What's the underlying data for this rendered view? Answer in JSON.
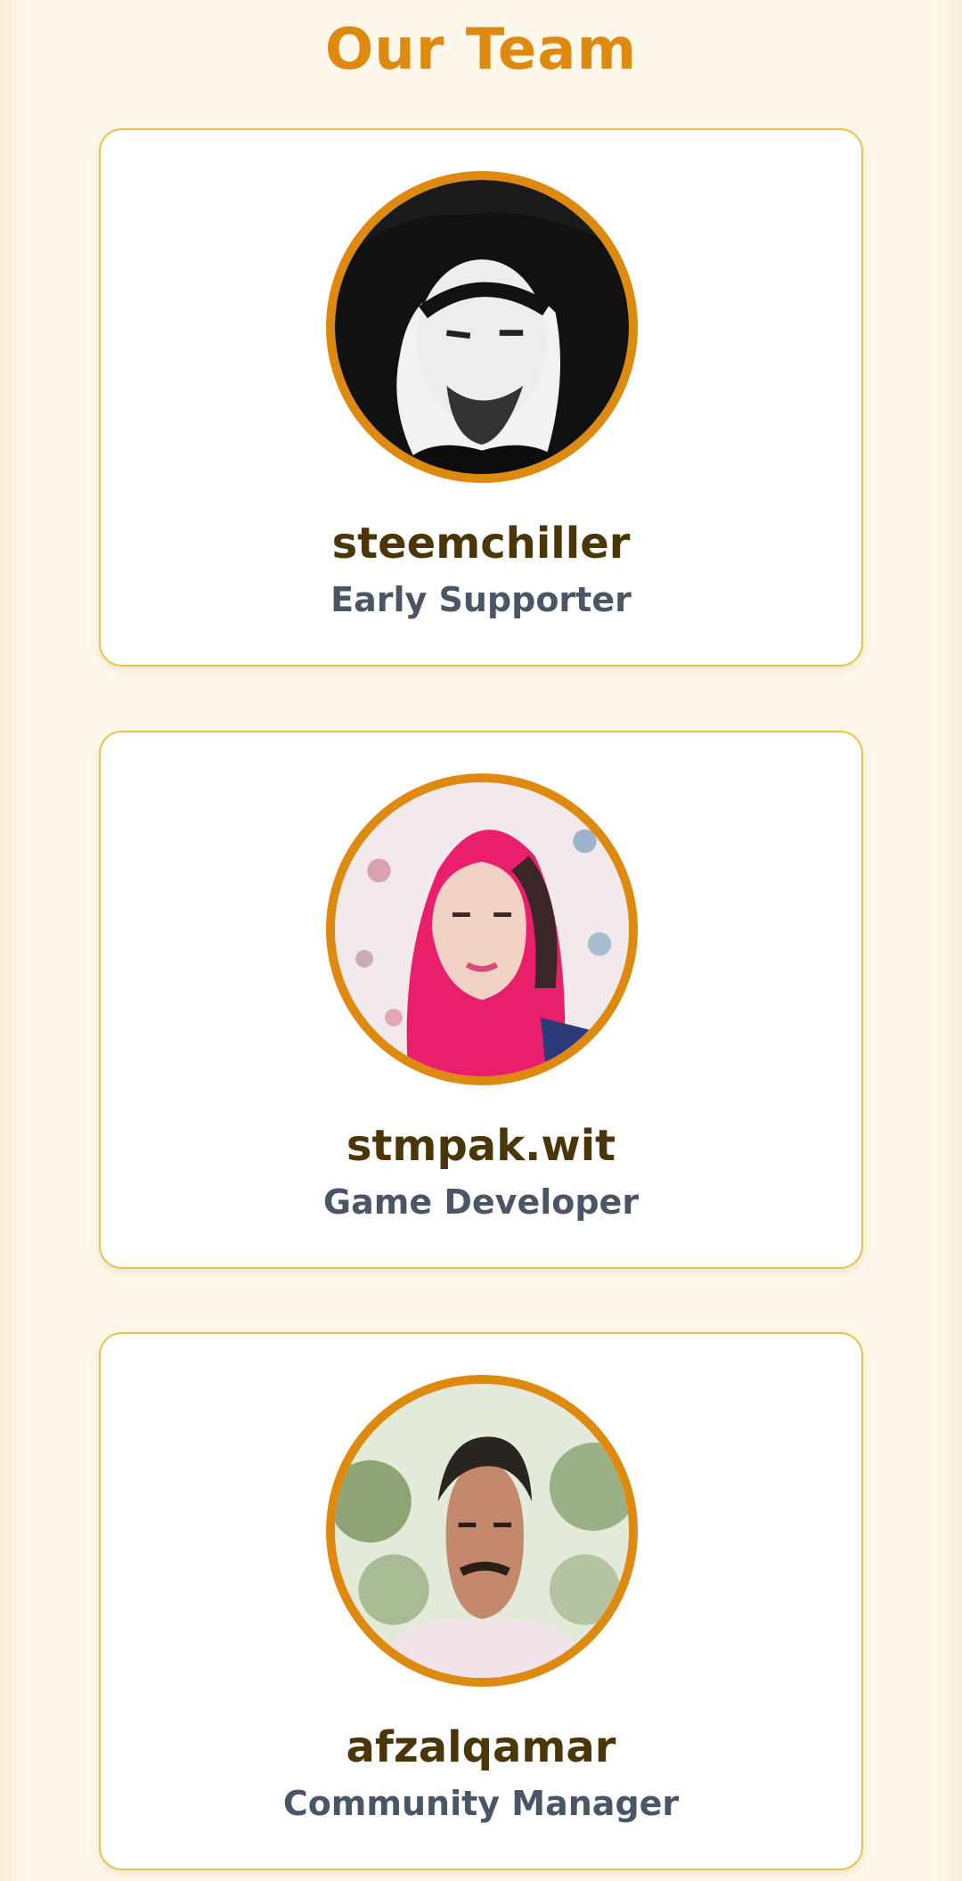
{
  "page": {
    "title": "Our Team"
  },
  "colors": {
    "accent": "#de8a10",
    "card_border": "#e8c24a",
    "background": "#fdf8e9",
    "name_text": "#4a3608",
    "role_text": "#4a5566"
  },
  "team": [
    {
      "name": "steemchiller",
      "role": "Early Supporter",
      "photo": "grayscale-portrait"
    },
    {
      "name": "stmpak.wit",
      "role": "Game Developer",
      "photo": "portrait-pink-headscarf"
    },
    {
      "name": "afzalqamar",
      "role": "Community Manager",
      "photo": "portrait-outdoor"
    }
  ]
}
